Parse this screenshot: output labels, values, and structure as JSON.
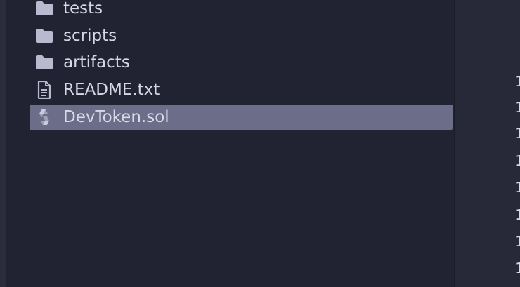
{
  "explorer": {
    "items": [
      {
        "label": "tests",
        "icon": "folder-icon",
        "type": "folder",
        "selected": false
      },
      {
        "label": "scripts",
        "icon": "folder-icon",
        "type": "folder",
        "selected": false
      },
      {
        "label": "artifacts",
        "icon": "folder-icon",
        "type": "folder",
        "selected": false
      },
      {
        "label": "README.txt",
        "icon": "file-text-icon",
        "type": "file",
        "selected": false
      },
      {
        "label": "DevToken.sol",
        "icon": "solidity-icon",
        "type": "file",
        "selected": true
      }
    ]
  },
  "editor": {
    "gutter": [
      "1",
      "1",
      "1",
      "1",
      "1",
      "1",
      "1",
      "1"
    ]
  },
  "colors": {
    "background": "#222332",
    "selection": "#6c6d88",
    "text": "#d6d7e6",
    "icon": "#b9bad0"
  }
}
